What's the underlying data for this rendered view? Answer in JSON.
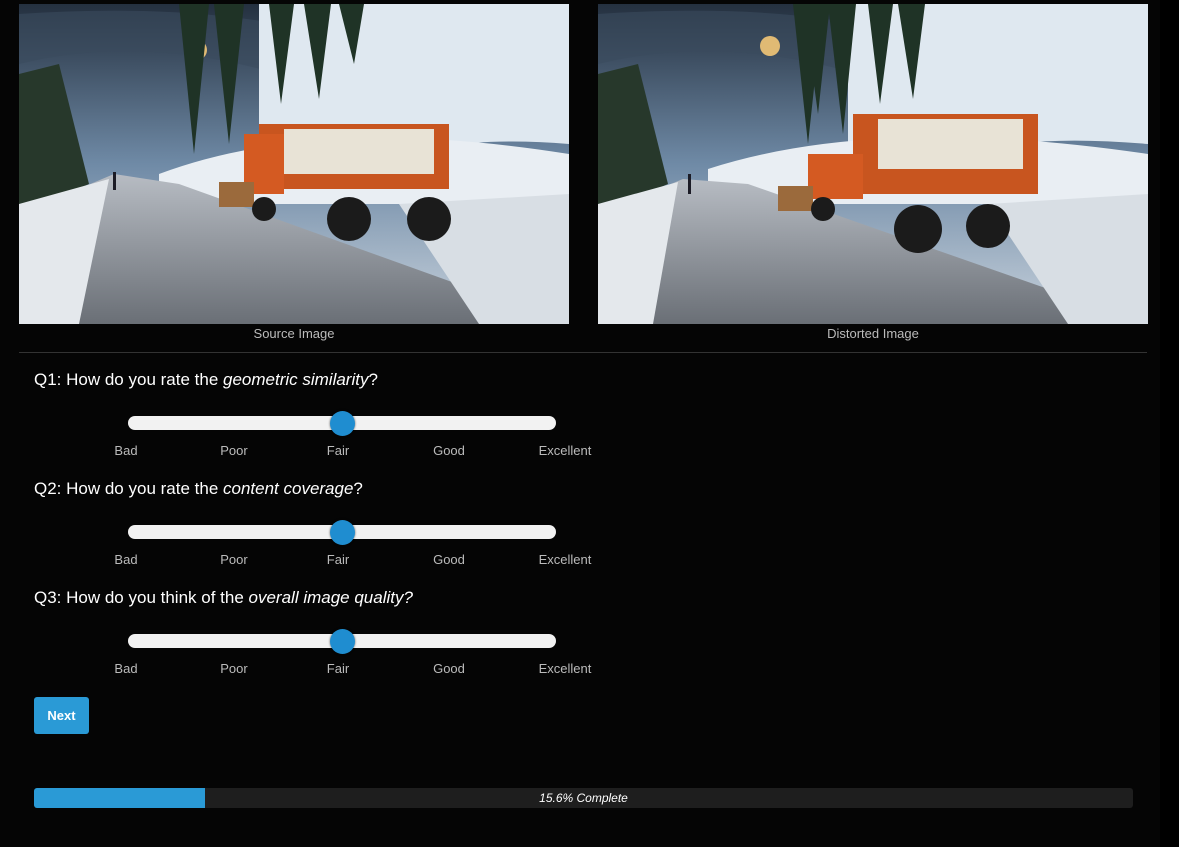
{
  "images": {
    "source_caption": "Source Image",
    "distorted_caption": "Distorted Image"
  },
  "questions": [
    {
      "prefix": "Q1: How do you rate the ",
      "emphasis": "geometric similarity",
      "suffix": "?",
      "value": 0.5
    },
    {
      "prefix": "Q2: How do you rate the ",
      "emphasis": "content coverage",
      "suffix": "?",
      "value": 0.5
    },
    {
      "prefix": "Q3: How do you think of the ",
      "emphasis": "overall image quality?",
      "suffix": "",
      "value": 0.5
    }
  ],
  "scale_labels": [
    "Bad",
    "Poor",
    "Fair",
    "Good",
    "Excellent"
  ],
  "next_label": "Next",
  "progress": {
    "fraction": 0.156,
    "label": "15.6% Complete"
  },
  "colors": {
    "accent": "#2a9ad6",
    "slider_thumb": "#1f8dd0",
    "background": "#050505"
  }
}
